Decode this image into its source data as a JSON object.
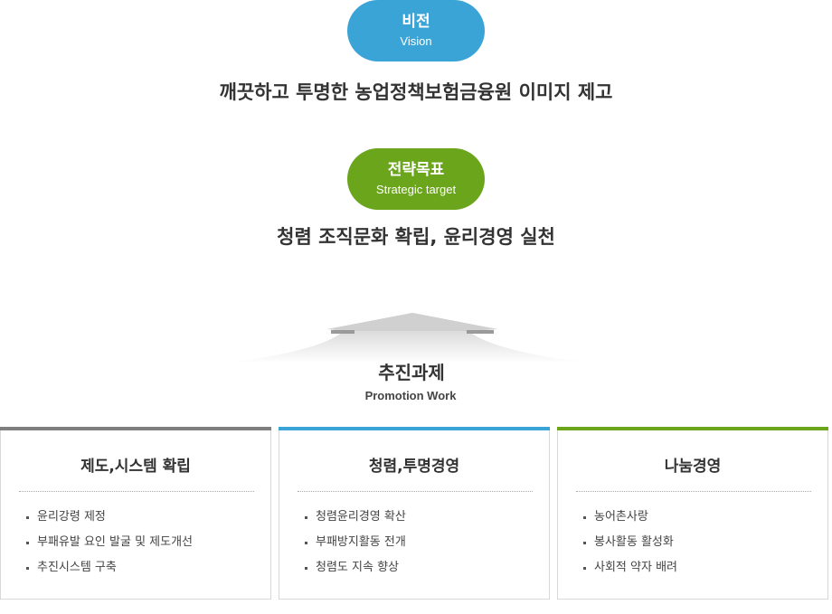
{
  "vision": {
    "label_ko": "비전",
    "label_en": "Vision",
    "statement": "깨끗하고 투명한 농업정책보험금융원 이미지 제고",
    "color": "#3ba4d6"
  },
  "strategic_target": {
    "label_ko": "전략목표",
    "label_en": "Strategic target",
    "statement": "청렴 조직문화 확립, 윤리경영 실천",
    "color": "#6aa51b"
  },
  "promotion": {
    "title": "추진과제",
    "subtitle": "Promotion Work"
  },
  "cards": [
    {
      "title": "제도,시스템 확립",
      "accent": "#7f7f7f",
      "items": [
        "윤리강령 제정",
        "부패유발 요인 발굴 및 제도개선",
        "추진시스템 구축"
      ]
    },
    {
      "title": "청렴,투명경영",
      "accent": "#3ba4d6",
      "items": [
        "청렴윤리경영 확산",
        "부패방지활동 전개",
        "청렴도 지속 향상"
      ]
    },
    {
      "title": "나눔경영",
      "accent": "#6aa51b",
      "items": [
        "농어촌사랑",
        "봉사활동 활성화",
        "사회적 약자 배려"
      ]
    }
  ]
}
